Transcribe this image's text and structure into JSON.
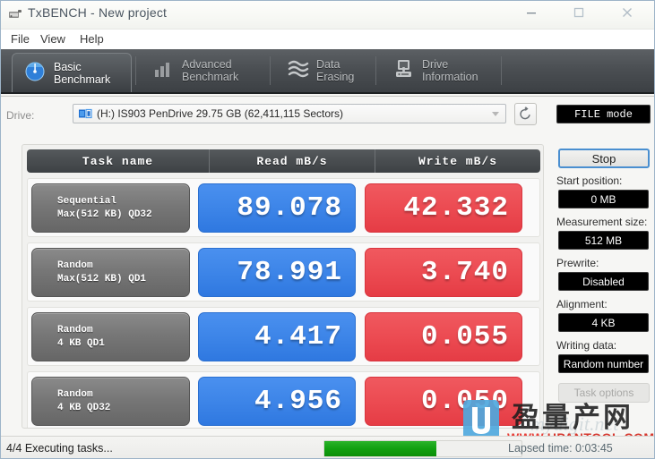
{
  "window": {
    "title": "TxBENCH - New project",
    "icon": "app-icon",
    "controls": {
      "minimize": "—",
      "maximize": "□",
      "close": "✕"
    }
  },
  "menubar": {
    "items": [
      "File",
      "View",
      "Help"
    ]
  },
  "tabs": [
    {
      "label": "Basic\nBenchmark",
      "icon": "gauge-icon",
      "active": true
    },
    {
      "label": "Advanced\nBenchmark",
      "icon": "bar-chart-icon",
      "active": false
    },
    {
      "label": "Data Erasing",
      "icon": "eraser-icon",
      "active": false
    },
    {
      "label": "Drive\nInformation",
      "icon": "drive-info-icon",
      "active": false
    }
  ],
  "drive": {
    "label": "Drive:",
    "selected": "(H:) IS903 PenDrive  29.75 GB (62,411,115 Sectors)",
    "refresh_tooltip": "refresh-icon"
  },
  "table": {
    "headers": [
      "Task name",
      "Read mB/s",
      "Write mB/s"
    ],
    "rows": [
      {
        "name_line1": "Sequential",
        "name_line2": "Max(512 KB) QD32",
        "read": "89.078",
        "write": "42.332"
      },
      {
        "name_line1": "Random",
        "name_line2": "Max(512 KB) QD1",
        "read": "78.991",
        "write": "3.740"
      },
      {
        "name_line1": "Random",
        "name_line2": "4 KB QD1",
        "read": "4.417",
        "write": "0.055"
      },
      {
        "name_line1": "Random",
        "name_line2": "4 KB QD32",
        "read": "4.956",
        "write": "0.050"
      }
    ]
  },
  "sidebar": {
    "mode_button": "FILE mode",
    "stop_button": "Stop",
    "fields": [
      {
        "label": "Start position:",
        "value": "0 MB"
      },
      {
        "label": "Measurement size:",
        "value": "512 MB"
      },
      {
        "label": "Prewrite:",
        "value": "Disabled"
      },
      {
        "label": "Alignment:",
        "value": "4 KB"
      },
      {
        "label": "Writing data:",
        "value": "Random number"
      }
    ],
    "task_options": "Task options"
  },
  "statusbar": {
    "text": "4/4 Executing tasks...",
    "progress_percent": 57,
    "lapsed": "Lapsed time: 0:03:45"
  },
  "watermark": {
    "chinese": "盈量产网",
    "www": "WWW.",
    "domain": "UPANTOOL.COM",
    "ghost": "mydigit.net"
  },
  "colors": {
    "read_blue": "#3d85e8",
    "write_red": "#ec4b52",
    "header_dark": "#494d50",
    "progress_green": "#11a011",
    "tab_bar": "#4b4f53"
  }
}
